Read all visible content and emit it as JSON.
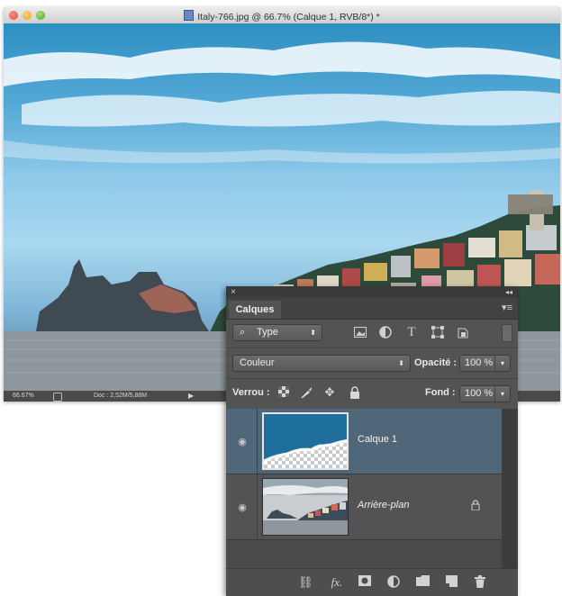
{
  "window": {
    "title": "Italy-766.jpg @ 66.7% (Calque 1, RVB/8*) *",
    "status": {
      "zoom": "66.67%",
      "doc": "Doc : 2,52M/5,88M"
    }
  },
  "panel": {
    "tab": "Calques",
    "filter": {
      "kind": "Type",
      "icons": [
        "image-filter-icon",
        "adjustment-filter-icon",
        "type-filter-icon",
        "shape-filter-icon",
        "smart-object-filter-icon"
      ]
    },
    "blend_mode": "Couleur",
    "opacity_label": "Opacité :",
    "opacity_value": "100 %",
    "lock_label": "Verrou :",
    "fill_label": "Fond :",
    "fill_value": "100 %",
    "layers": [
      {
        "name": "Calque 1",
        "selected": true,
        "visible": true
      },
      {
        "name": "Arrière-plan",
        "selected": false,
        "visible": true,
        "locked": true
      }
    ],
    "bottom_icons": [
      "link-layers-icon",
      "fx-icon",
      "add-mask-icon",
      "adjustment-layer-icon",
      "new-group-icon",
      "new-layer-icon",
      "trash-icon"
    ]
  },
  "colors": {
    "panel_bg": "#535353",
    "selected_layer": "#506779",
    "sky_blue": "#2e8fc2"
  }
}
